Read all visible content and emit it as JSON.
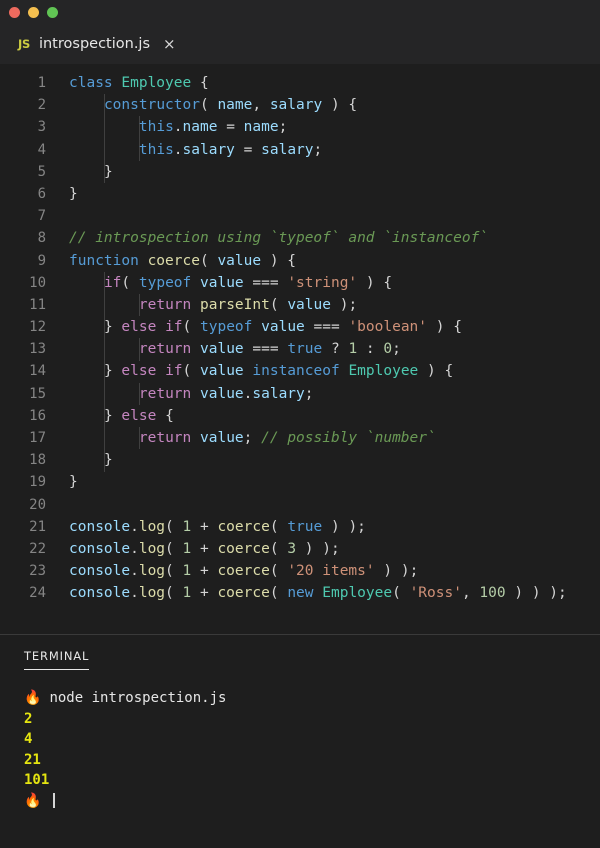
{
  "window": {
    "traffic_lights": [
      {
        "name": "close",
        "color": "#ed6a5e"
      },
      {
        "name": "minimize",
        "color": "#f4bf4f"
      },
      {
        "name": "maximize",
        "color": "#61c554"
      }
    ]
  },
  "tab": {
    "icon_label": "JS",
    "filename": "introspection.js",
    "close_glyph": "×"
  },
  "editor": {
    "language": "javascript",
    "line_numbers": [
      "1",
      "2",
      "3",
      "4",
      "5",
      "6",
      "7",
      "8",
      "9",
      "10",
      "11",
      "12",
      "13",
      "14",
      "15",
      "16",
      "17",
      "18",
      "19",
      "20",
      "21",
      "22",
      "23",
      "24"
    ],
    "lines": [
      {
        "n": "1",
        "text": "class Employee {"
      },
      {
        "n": "2",
        "text": "    constructor( name, salary ) {"
      },
      {
        "n": "3",
        "text": "        this.name = name;"
      },
      {
        "n": "4",
        "text": "        this.salary = salary;"
      },
      {
        "n": "5",
        "text": "    }"
      },
      {
        "n": "6",
        "text": "}"
      },
      {
        "n": "7",
        "text": ""
      },
      {
        "n": "8",
        "text": "// introspection using `typeof` and `instanceof`"
      },
      {
        "n": "9",
        "text": "function coerce( value ) {"
      },
      {
        "n": "10",
        "text": "    if( typeof value === 'string' ) {"
      },
      {
        "n": "11",
        "text": "        return parseInt( value );"
      },
      {
        "n": "12",
        "text": "    } else if( typeof value === 'boolean' ) {"
      },
      {
        "n": "13",
        "text": "        return value === true ? 1 : 0;"
      },
      {
        "n": "14",
        "text": "    } else if( value instanceof Employee ) {"
      },
      {
        "n": "15",
        "text": "        return value.salary;"
      },
      {
        "n": "16",
        "text": "    } else {"
      },
      {
        "n": "17",
        "text": "        return value; // possibly `number`"
      },
      {
        "n": "18",
        "text": "    }"
      },
      {
        "n": "19",
        "text": "}"
      },
      {
        "n": "20",
        "text": ""
      },
      {
        "n": "21",
        "text": "console.log( 1 + coerce( true ) );"
      },
      {
        "n": "22",
        "text": "console.log( 1 + coerce( 3 ) );"
      },
      {
        "n": "23",
        "text": "console.log( 1 + coerce( '20 items' ) );"
      },
      {
        "n": "24",
        "text": "console.log( 1 + coerce( new Employee( 'Ross', 100 ) ) );"
      }
    ],
    "colors": {
      "background": "#1e1e1e",
      "foreground": "#d4d4d4",
      "line_number": "#858585",
      "keyword": "#569cd6",
      "control_keyword": "#c586c0",
      "type": "#4ec9b0",
      "function": "#dcdcaa",
      "variable": "#9cdcfe",
      "string": "#ce9178",
      "number": "#b5cea8",
      "comment": "#6a9955",
      "indent_guide": "#404040"
    }
  },
  "panel": {
    "tab_label": "TERMINAL",
    "prompt_glyph": "🔥",
    "command": "node introspection.js",
    "output": [
      "2",
      "4",
      "21",
      "101"
    ],
    "output_color": "#e5e510",
    "command_color": "#e6e6e6"
  }
}
